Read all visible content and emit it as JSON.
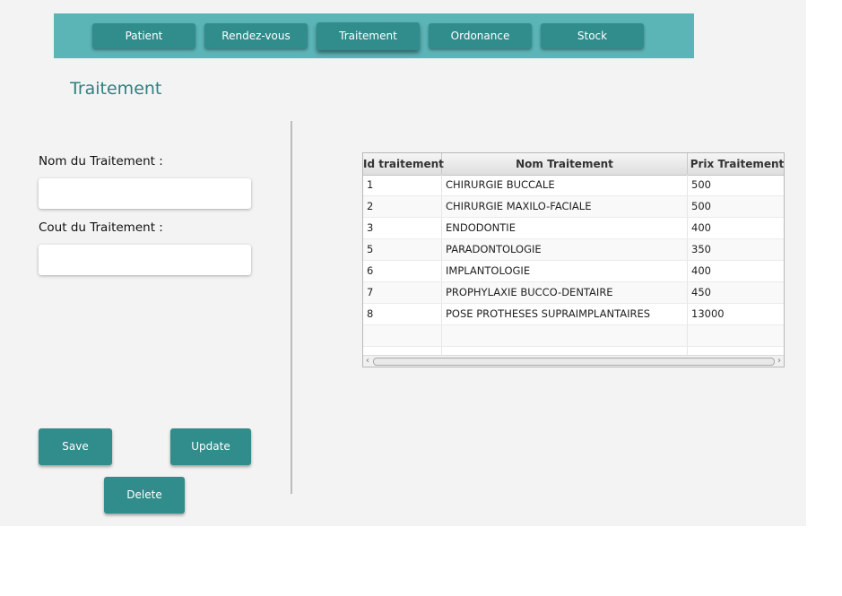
{
  "nav": {
    "tabs": [
      {
        "label": "Patient"
      },
      {
        "label": "Rendez-vous"
      },
      {
        "label": "Traitement"
      },
      {
        "label": "Ordonance"
      },
      {
        "label": "Stock"
      }
    ],
    "active_tab": "Traitement"
  },
  "page": {
    "title": "Traitement"
  },
  "form": {
    "name_label": "Nom du Traitement :",
    "name_value": "",
    "cost_label": "Cout du Traitement :",
    "cost_value": ""
  },
  "actions": {
    "save_label": "Save",
    "update_label": "Update",
    "delete_label": "Delete"
  },
  "table": {
    "columns": [
      "Id traitement",
      "Nom Traitement",
      "Prix Traitement"
    ],
    "rows": [
      [
        "1",
        "CHIRURGIE BUCCALE",
        "500"
      ],
      [
        "2",
        "CHIRURGIE MAXILO-FACIALE",
        "500"
      ],
      [
        "3",
        "ENDODONTIE",
        "400"
      ],
      [
        "5",
        "PARADONTOLOGIE",
        "350"
      ],
      [
        "6",
        "IMPLANTOLOGIE",
        "400"
      ],
      [
        "7",
        "PROPHYLAXIE BUCCO-DENTAIRE",
        "450"
      ],
      [
        "8",
        "POSE PROTHESES SUPRAIMPLANTAIRES",
        "13000"
      ],
      [
        "",
        "",
        ""
      ],
      [
        "",
        "",
        ""
      ]
    ]
  },
  "colors": {
    "accent": "#318c8c",
    "nav_background": "#5bb4b6",
    "title": "#2f8080",
    "panel_background": "#f3f3f3"
  },
  "icons": {
    "scroll_left": "chevron-left-icon",
    "scroll_right": "chevron-right-icon"
  }
}
